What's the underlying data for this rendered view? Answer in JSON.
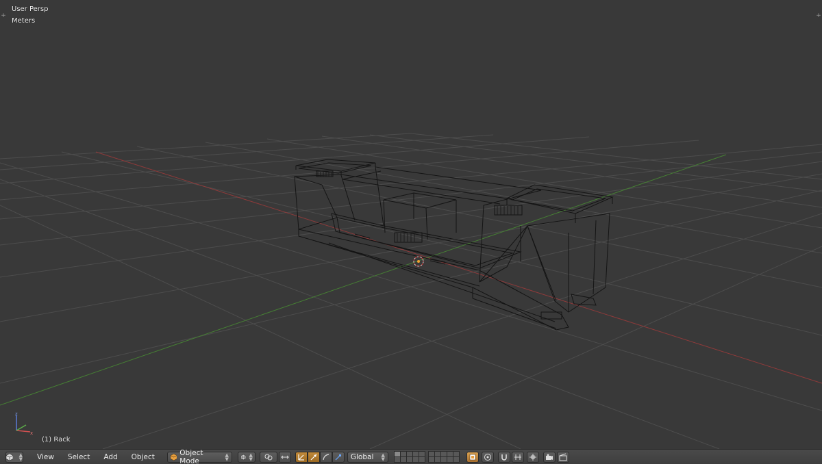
{
  "viewport": {
    "view_name": "User Persp",
    "units": "Meters",
    "active_object": "(1) Rack"
  },
  "header": {
    "menus": [
      "View",
      "Select",
      "Add",
      "Object"
    ],
    "mode": "Object Mode",
    "orientation": "Global"
  },
  "colors": {
    "background": "#393939",
    "grid": "#4c4c4c",
    "x_axis": "#9b3b3b",
    "y_axis": "#4e8f3a",
    "wire": "#151515",
    "header": "#444444",
    "active_button": "#b07a2c"
  },
  "icons": {
    "editor_type": "cube-icon",
    "mode": "object-cube-icon",
    "viewport_shading": "sphere-icon",
    "pivot": "pivot-icon",
    "manipulator": "manipulator-icon",
    "snap": "magnet-icon",
    "render": "camera-icon"
  }
}
